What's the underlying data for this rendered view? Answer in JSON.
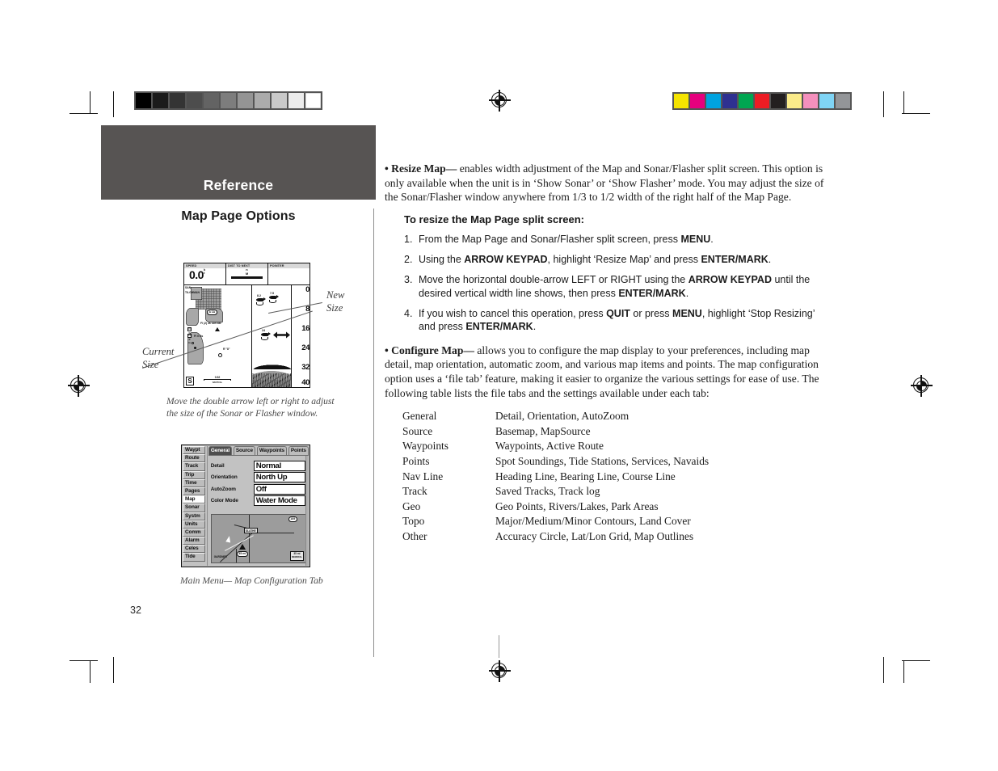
{
  "document": {
    "running_head": "Reference",
    "section_title": "Map Page Options",
    "page_number": "32"
  },
  "right_column": {
    "resize_map": {
      "lead": "• Resize Map—",
      "text": " enables width adjustment of the Map and Sonar/Flasher split screen. This option is only available when the unit is in  ‘Show Sonar’ or ‘Show Flasher’ mode. You may adjust the size of the Sonar/Flasher window anywhere from 1/3 to 1/2 width of the right half of the Map Page."
    },
    "procedure_title": "To resize the Map Page split screen:",
    "steps": [
      {
        "num": "1.",
        "html": "From the Map Page and Sonar/Flasher split screen, press <b>MENU</b>."
      },
      {
        "num": "2.",
        "html": "Using the <b>ARROW KEYPAD</b>, highlight ‘Resize Map’ and press <b>ENTER/MARK</b>."
      },
      {
        "num": "3.",
        "html": "Move the horizontal double-arrow LEFT or RIGHT using the <b>ARROW KEYPAD</b> until the desired vertical width line shows, then press <b>ENTER/MARK</b>."
      },
      {
        "num": "4.",
        "html": "If you wish to cancel this operation, press <b>QUIT</b> or press <b>MENU</b>, highlight ‘Stop Resizing’ and press <b>ENTER/MARK</b>."
      }
    ],
    "configure_map": {
      "lead": "• Configure Map—",
      "text": " allows you to configure the map display to your preferences, including map detail, map orientation, automatic zoom, and various map items and points. The map configuration option uses a ‘file tab’ feature, making it easier to organize the various settings for ease of use. The following table lists the file tabs and the settings available under each tab:"
    },
    "config_table": [
      {
        "tab": "General",
        "settings": "Detail, Orientation, AutoZoom"
      },
      {
        "tab": "Source",
        "settings": "Basemap, MapSource"
      },
      {
        "tab": "Waypoints",
        "settings": "Waypoints, Active Route"
      },
      {
        "tab": "Points",
        "settings": "Spot Soundings, Tide Stations, Services, Navaids"
      },
      {
        "tab": "Nav Line",
        "settings": "Heading Line, Bearing Line, Course Line"
      },
      {
        "tab": "Track",
        "settings": "Saved Tracks, Track log"
      },
      {
        "tab": "Geo",
        "settings": "Geo Points, Rivers/Lakes, Park Areas"
      },
      {
        "tab": "Topo",
        "settings": "Major/Medium/Minor Contours, Land Cover"
      },
      {
        "tab": "Other",
        "settings": "Accuracy Circle, Lat/Lon Grid, Map Outlines"
      }
    ]
  },
  "figure_split_screen": {
    "caption": "Move the double arrow left or right to adjust the size of the Sonar or Flasher window.",
    "callout_current": "Current\nSize",
    "callout_current_line1": "Current",
    "callout_current_line2": "Size",
    "callout_new_line1": "New",
    "callout_new_line2": "Size",
    "data_fields": [
      {
        "label": "SPEED",
        "value": "0.0",
        "unit_top": "k",
        "unit_bottom": "t"
      },
      {
        "label": "DIST TO NEXT",
        "value": "n",
        "sub": "M"
      },
      {
        "label": "POINTER",
        "value": ""
      }
    ],
    "depth_scale": [
      "0",
      "8",
      "16",
      "24",
      "32",
      "40"
    ],
    "map_labels": [
      "SAN",
      "TILGHMAN",
      "A 1A",
      "FI G 4s",
      "FI R 4s",
      "R \"8\"",
      "0.52",
      "S"
    ],
    "map_note": "Fl (2) 4s 33ft 6M",
    "scale_unit": "NAUTICAL",
    "fish_tags": [
      "8.2",
      "7.5",
      "24"
    ]
  },
  "figure_main_menu": {
    "caption": "Main Menu— Map Configuration Tab",
    "side_tabs": [
      {
        "label": "Waypt",
        "selected": false
      },
      {
        "label": "Route",
        "selected": false
      },
      {
        "label": "Track",
        "selected": false
      },
      {
        "label": "Trip",
        "selected": false
      },
      {
        "label": "Time",
        "selected": false
      },
      {
        "label": "Pages",
        "selected": false
      },
      {
        "label": "Map",
        "selected": true
      },
      {
        "label": "Sonar",
        "selected": false
      },
      {
        "label": "Systm",
        "selected": false
      },
      {
        "label": "Units",
        "selected": false
      },
      {
        "label": "Comm",
        "selected": false
      },
      {
        "label": "Alarm",
        "selected": false
      },
      {
        "label": "Celes",
        "selected": false
      },
      {
        "label": "Tide",
        "selected": false
      }
    ],
    "file_tabs": [
      {
        "label": "General",
        "selected": true
      },
      {
        "label": "Source",
        "selected": false
      },
      {
        "label": "Waypoints",
        "selected": false
      },
      {
        "label": "Points",
        "selected": false
      }
    ],
    "settings": [
      {
        "label": "Detail",
        "value": "Normal"
      },
      {
        "label": "Orientation",
        "value": "North Up"
      },
      {
        "label": "AutoZoom",
        "value": "Off"
      },
      {
        "label": "Color Mode",
        "value": "Water Mode"
      }
    ],
    "map_labels": [
      "OLATHE",
      "169",
      "I 35",
      "GARDNER",
      "35 mi",
      "MEMORIAL"
    ]
  },
  "print_marks": {
    "grayscale_patches": [
      "#000000",
      "#1b1b1b",
      "#343434",
      "#4d4d4d",
      "#636363",
      "#7d7d7d",
      "#949494",
      "#ababab",
      "#c9c9c9",
      "#ececec",
      "#ffffff"
    ],
    "color_patches": [
      "#f5e400",
      "#e6007e",
      "#00a3e0",
      "#2e3191",
      "#00a651",
      "#ed1c24",
      "#231f20",
      "#fbeb8a",
      "#f490bd",
      "#7fd4f5",
      "#939598"
    ],
    "band_color": "#575453"
  }
}
